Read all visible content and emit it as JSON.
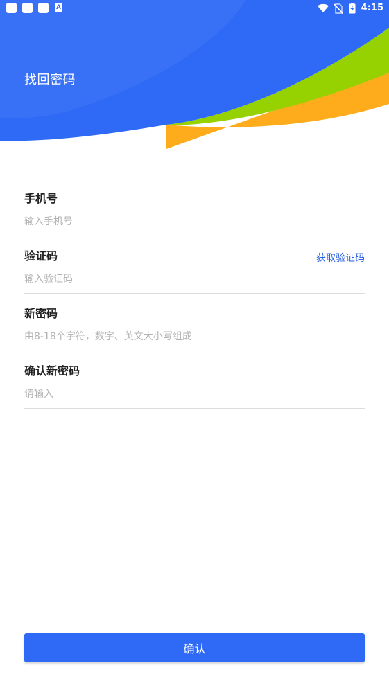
{
  "status_bar": {
    "time": "4:15",
    "notification_icons": [
      "app-notification-icon",
      "app-notification-icon",
      "app-notification-icon",
      "a-notification-icon"
    ],
    "a_icon_letter": "A",
    "right_icons": [
      "wifi-icon",
      "no-sim-icon",
      "battery-charging-icon"
    ]
  },
  "header": {
    "title": "找回密码",
    "colors": {
      "blue": "#2f6af6",
      "green": "#96d102",
      "orange": "#ffac1c"
    }
  },
  "form": {
    "phone": {
      "label": "手机号",
      "placeholder": "输入手机号",
      "value": ""
    },
    "code": {
      "label": "验证码",
      "placeholder": "输入验证码",
      "value": "",
      "get_code_label": "获取验证码"
    },
    "new_password": {
      "label": "新密码",
      "placeholder": "由8-18个字符，数字、英文大小写组成",
      "value": ""
    },
    "confirm_password": {
      "label": "确认新密码",
      "placeholder": "请输入",
      "value": ""
    }
  },
  "actions": {
    "confirm_label": "确认"
  },
  "theme": {
    "accent": "#2f6af6",
    "link": "#2b62e3",
    "divider": "#dcdcdc"
  }
}
